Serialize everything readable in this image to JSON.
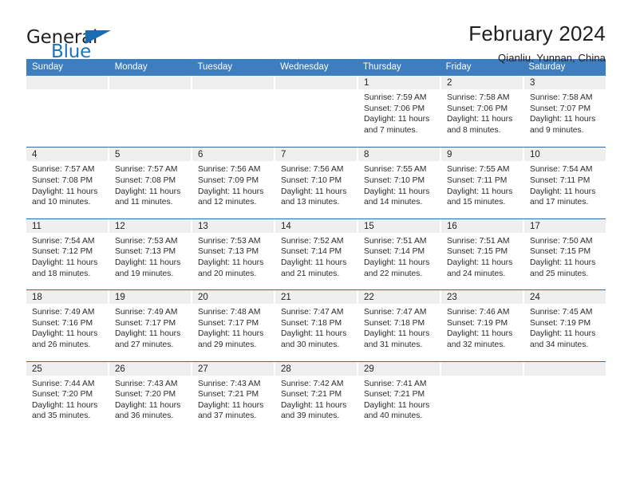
{
  "logo": {
    "word_top": "General",
    "word_bottom": "Blue",
    "triangle_color": "#1b6cb0",
    "blue_color": "#1b75bb"
  },
  "header": {
    "title": "February 2024",
    "location": "Qianliu, Yunnan, China"
  },
  "theme": {
    "header_blue": "#3c7ebf",
    "rule_blue": "#2f6ca8",
    "daynum_band": "#efefef"
  },
  "weekdays": [
    "Sunday",
    "Monday",
    "Tuesday",
    "Wednesday",
    "Thursday",
    "Friday",
    "Saturday"
  ],
  "weeks": [
    [
      {
        "day": "",
        "sunrise": "",
        "sunset": "",
        "daylight1": "",
        "daylight2": ""
      },
      {
        "day": "",
        "sunrise": "",
        "sunset": "",
        "daylight1": "",
        "daylight2": ""
      },
      {
        "day": "",
        "sunrise": "",
        "sunset": "",
        "daylight1": "",
        "daylight2": ""
      },
      {
        "day": "",
        "sunrise": "",
        "sunset": "",
        "daylight1": "",
        "daylight2": ""
      },
      {
        "day": "1",
        "sunrise": "Sunrise: 7:59 AM",
        "sunset": "Sunset: 7:06 PM",
        "daylight1": "Daylight: 11 hours",
        "daylight2": "and 7 minutes."
      },
      {
        "day": "2",
        "sunrise": "Sunrise: 7:58 AM",
        "sunset": "Sunset: 7:06 PM",
        "daylight1": "Daylight: 11 hours",
        "daylight2": "and 8 minutes."
      },
      {
        "day": "3",
        "sunrise": "Sunrise: 7:58 AM",
        "sunset": "Sunset: 7:07 PM",
        "daylight1": "Daylight: 11 hours",
        "daylight2": "and 9 minutes."
      }
    ],
    [
      {
        "day": "4",
        "sunrise": "Sunrise: 7:57 AM",
        "sunset": "Sunset: 7:08 PM",
        "daylight1": "Daylight: 11 hours",
        "daylight2": "and 10 minutes."
      },
      {
        "day": "5",
        "sunrise": "Sunrise: 7:57 AM",
        "sunset": "Sunset: 7:08 PM",
        "daylight1": "Daylight: 11 hours",
        "daylight2": "and 11 minutes."
      },
      {
        "day": "6",
        "sunrise": "Sunrise: 7:56 AM",
        "sunset": "Sunset: 7:09 PM",
        "daylight1": "Daylight: 11 hours",
        "daylight2": "and 12 minutes."
      },
      {
        "day": "7",
        "sunrise": "Sunrise: 7:56 AM",
        "sunset": "Sunset: 7:10 PM",
        "daylight1": "Daylight: 11 hours",
        "daylight2": "and 13 minutes."
      },
      {
        "day": "8",
        "sunrise": "Sunrise: 7:55 AM",
        "sunset": "Sunset: 7:10 PM",
        "daylight1": "Daylight: 11 hours",
        "daylight2": "and 14 minutes."
      },
      {
        "day": "9",
        "sunrise": "Sunrise: 7:55 AM",
        "sunset": "Sunset: 7:11 PM",
        "daylight1": "Daylight: 11 hours",
        "daylight2": "and 15 minutes."
      },
      {
        "day": "10",
        "sunrise": "Sunrise: 7:54 AM",
        "sunset": "Sunset: 7:11 PM",
        "daylight1": "Daylight: 11 hours",
        "daylight2": "and 17 minutes."
      }
    ],
    [
      {
        "day": "11",
        "sunrise": "Sunrise: 7:54 AM",
        "sunset": "Sunset: 7:12 PM",
        "daylight1": "Daylight: 11 hours",
        "daylight2": "and 18 minutes."
      },
      {
        "day": "12",
        "sunrise": "Sunrise: 7:53 AM",
        "sunset": "Sunset: 7:13 PM",
        "daylight1": "Daylight: 11 hours",
        "daylight2": "and 19 minutes."
      },
      {
        "day": "13",
        "sunrise": "Sunrise: 7:53 AM",
        "sunset": "Sunset: 7:13 PM",
        "daylight1": "Daylight: 11 hours",
        "daylight2": "and 20 minutes."
      },
      {
        "day": "14",
        "sunrise": "Sunrise: 7:52 AM",
        "sunset": "Sunset: 7:14 PM",
        "daylight1": "Daylight: 11 hours",
        "daylight2": "and 21 minutes."
      },
      {
        "day": "15",
        "sunrise": "Sunrise: 7:51 AM",
        "sunset": "Sunset: 7:14 PM",
        "daylight1": "Daylight: 11 hours",
        "daylight2": "and 22 minutes."
      },
      {
        "day": "16",
        "sunrise": "Sunrise: 7:51 AM",
        "sunset": "Sunset: 7:15 PM",
        "daylight1": "Daylight: 11 hours",
        "daylight2": "and 24 minutes."
      },
      {
        "day": "17",
        "sunrise": "Sunrise: 7:50 AM",
        "sunset": "Sunset: 7:15 PM",
        "daylight1": "Daylight: 11 hours",
        "daylight2": "and 25 minutes."
      }
    ],
    [
      {
        "day": "18",
        "sunrise": "Sunrise: 7:49 AM",
        "sunset": "Sunset: 7:16 PM",
        "daylight1": "Daylight: 11 hours",
        "daylight2": "and 26 minutes."
      },
      {
        "day": "19",
        "sunrise": "Sunrise: 7:49 AM",
        "sunset": "Sunset: 7:17 PM",
        "daylight1": "Daylight: 11 hours",
        "daylight2": "and 27 minutes."
      },
      {
        "day": "20",
        "sunrise": "Sunrise: 7:48 AM",
        "sunset": "Sunset: 7:17 PM",
        "daylight1": "Daylight: 11 hours",
        "daylight2": "and 29 minutes."
      },
      {
        "day": "21",
        "sunrise": "Sunrise: 7:47 AM",
        "sunset": "Sunset: 7:18 PM",
        "daylight1": "Daylight: 11 hours",
        "daylight2": "and 30 minutes."
      },
      {
        "day": "22",
        "sunrise": "Sunrise: 7:47 AM",
        "sunset": "Sunset: 7:18 PM",
        "daylight1": "Daylight: 11 hours",
        "daylight2": "and 31 minutes."
      },
      {
        "day": "23",
        "sunrise": "Sunrise: 7:46 AM",
        "sunset": "Sunset: 7:19 PM",
        "daylight1": "Daylight: 11 hours",
        "daylight2": "and 32 minutes."
      },
      {
        "day": "24",
        "sunrise": "Sunrise: 7:45 AM",
        "sunset": "Sunset: 7:19 PM",
        "daylight1": "Daylight: 11 hours",
        "daylight2": "and 34 minutes."
      }
    ],
    [
      {
        "day": "25",
        "sunrise": "Sunrise: 7:44 AM",
        "sunset": "Sunset: 7:20 PM",
        "daylight1": "Daylight: 11 hours",
        "daylight2": "and 35 minutes."
      },
      {
        "day": "26",
        "sunrise": "Sunrise: 7:43 AM",
        "sunset": "Sunset: 7:20 PM",
        "daylight1": "Daylight: 11 hours",
        "daylight2": "and 36 minutes."
      },
      {
        "day": "27",
        "sunrise": "Sunrise: 7:43 AM",
        "sunset": "Sunset: 7:21 PM",
        "daylight1": "Daylight: 11 hours",
        "daylight2": "and 37 minutes."
      },
      {
        "day": "28",
        "sunrise": "Sunrise: 7:42 AM",
        "sunset": "Sunset: 7:21 PM",
        "daylight1": "Daylight: 11 hours",
        "daylight2": "and 39 minutes."
      },
      {
        "day": "29",
        "sunrise": "Sunrise: 7:41 AM",
        "sunset": "Sunset: 7:21 PM",
        "daylight1": "Daylight: 11 hours",
        "daylight2": "and 40 minutes."
      },
      {
        "day": "",
        "sunrise": "",
        "sunset": "",
        "daylight1": "",
        "daylight2": ""
      },
      {
        "day": "",
        "sunrise": "",
        "sunset": "",
        "daylight1": "",
        "daylight2": ""
      }
    ]
  ]
}
